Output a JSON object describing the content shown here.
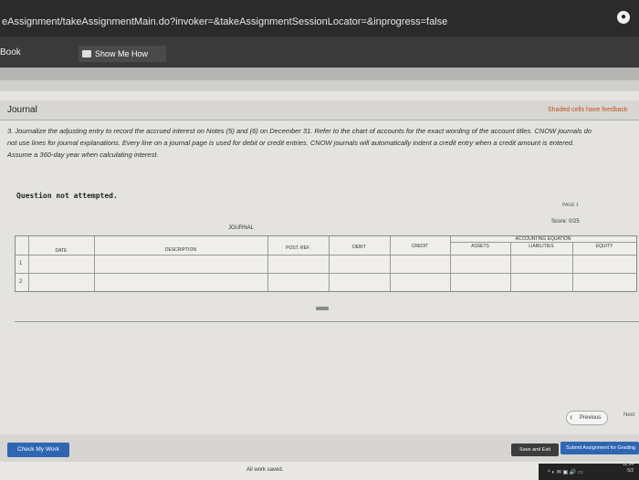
{
  "browser": {
    "url": "eAssignment/takeAssignmentMain.do?invoker=&takeAssignmentSessionLocator=&inprogress=false",
    "profile_icon": "profile-icon"
  },
  "toolbar": {
    "book_label": "Book",
    "show_me_how_label": "Show Me How"
  },
  "journal": {
    "title": "Journal",
    "shaded_note": "Shaded cells have feedback",
    "instructions": [
      "3. Journalize the adjusting entry to record the accrued interest on Notes (5) and (6) on December 31. Refer to the chart of accounts for the exact wording of the account titles. CNOW journals do",
      "not use lines for journal explanations. Every line on a journal page is used for debit or credit entries. CNOW journals will automatically indent a credit entry when a credit amount is entered.",
      "Assume a 360-day year when calculating interest."
    ],
    "question_status": "Question not attempted.",
    "page_tag": "PAGE 1",
    "score": "Score: 0/25",
    "table_title": "JOURNAL",
    "columns": {
      "date": "DATE",
      "description": "DESCRIPTION",
      "post_ref": "POST. REF.",
      "debit": "DEBIT",
      "credit": "CREDIT",
      "accounting_equation": "ACCOUNTING EQUATION",
      "assets": "ASSETS",
      "liabilities": "LIABILITIES",
      "equity": "EQUITY"
    },
    "rows": [
      "1",
      "2"
    ]
  },
  "nav": {
    "previous_label": "Previous",
    "next_label": "Next"
  },
  "footer": {
    "check_my_work_label": "Check My Work",
    "save_and_exit_label": "Save and Exit",
    "submit_label": "Submit Assignment for Grading",
    "saved_status": "All work saved."
  },
  "system_tray": {
    "icons": "^ ◐ ✉ ▣ 🔊 ▭",
    "time": "11:14",
    "date": "5/2"
  }
}
